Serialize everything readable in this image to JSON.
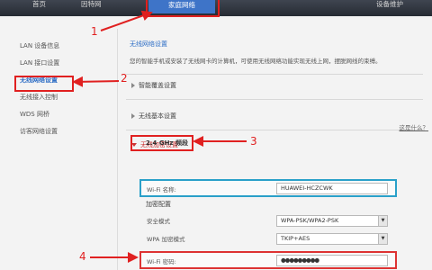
{
  "topnav": {
    "items": [
      {
        "label": "首页"
      },
      {
        "label": "因特网"
      },
      {
        "label": "家庭网络"
      },
      {
        "label": "设备维护"
      }
    ]
  },
  "sidebar": {
    "items": [
      {
        "label": "LAN 设备信息"
      },
      {
        "label": "LAN 接口设置"
      },
      {
        "label": "无线网络设置"
      },
      {
        "label": "无线接入控制"
      },
      {
        "label": "WDS 网桥"
      },
      {
        "label": "访客网络设置"
      }
    ]
  },
  "main": {
    "title": "无线网络设置",
    "description": "您的智能手机或安装了无线网卡的计算机，可使用无线网络功能实现无线上网，摆脱网线的束缚。",
    "sections": {
      "coverage": "智能覆盖设置",
      "basic": "无线基本设置",
      "encryption": "无线加密设置"
    },
    "help_link": "这是什么？",
    "band_title": "2.4 GHz 频段",
    "wifi_name_label": "Wi-Fi 名称:",
    "wifi_name_value": "HUAWEI-HCZCWK",
    "encryption_config": "加密配置",
    "security_mode_label": "安全模式",
    "security_mode_value": "WPA-PSK/WPA2-PSK",
    "wpa_mode_label": "WPA 加密模式",
    "wpa_mode_value": "TKIP+AES",
    "wifi_pwd_label": "Wi-Fi 密码:",
    "wifi_pwd_value": "●●●●●●●●●"
  },
  "annotations": {
    "n1": "1",
    "n2": "2",
    "n3": "3",
    "n4": "4",
    "color": "#e02020"
  }
}
